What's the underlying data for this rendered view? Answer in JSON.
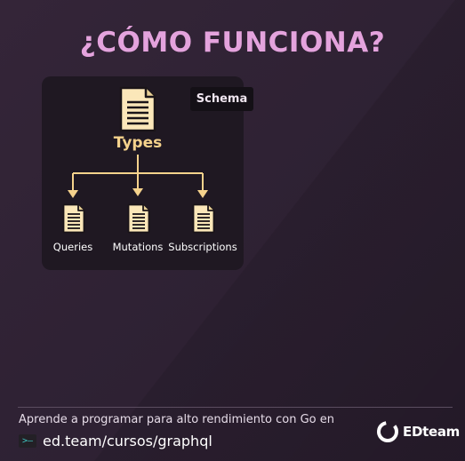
{
  "title": "¿CÓMO FUNCIONA?",
  "diagram": {
    "badge": "Schema",
    "root": {
      "label": "Types",
      "icon": "document-icon"
    },
    "children": [
      {
        "label": "Queries",
        "icon": "document-icon"
      },
      {
        "label": "Mutations",
        "icon": "document-icon"
      },
      {
        "label": "Subscriptions",
        "icon": "document-icon"
      }
    ]
  },
  "footer": {
    "text": "Aprende a programar para alto rendimiento con Go en",
    "terminal_glyph": ">–",
    "url": "ed.team/cursos/graphql",
    "brand": "EDteam"
  },
  "colors": {
    "title": "#e4a3dd",
    "accent": "#f5d28c",
    "doc_fill": "#fbe7b9",
    "background": "#2e2133",
    "panel": "#1f1822"
  }
}
